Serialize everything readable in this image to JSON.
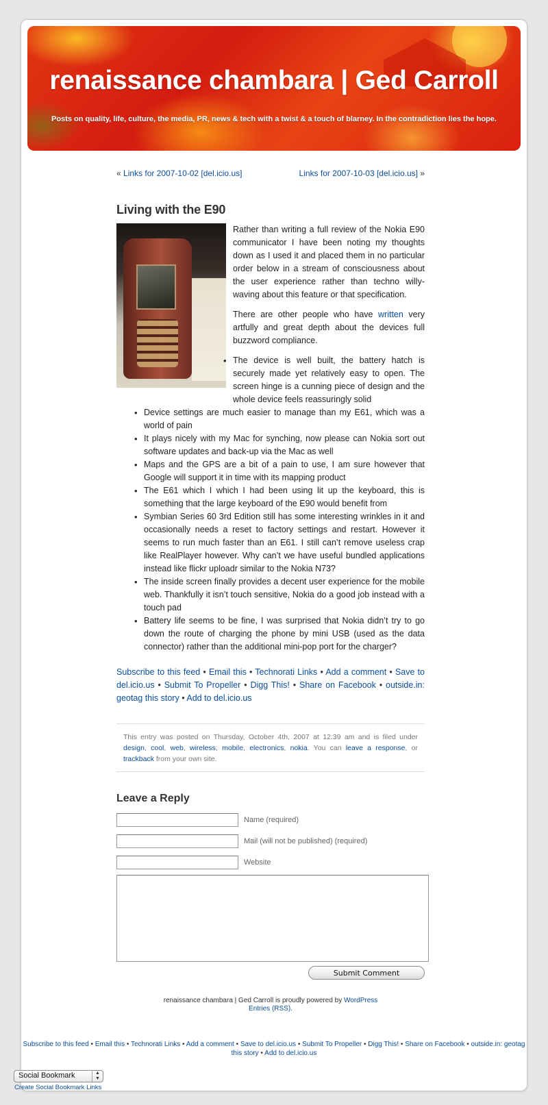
{
  "header": {
    "title": "renaissance chambara | Ged Carroll",
    "description": "Posts on quality, life, culture, the media, PR, news & tech with a twist & a touch of blarney. In the contradiction lies the hope."
  },
  "post_nav": {
    "prev_prefix": "« ",
    "prev_label": "Links for 2007-10-02 [del.icio.us]",
    "next_label": "Links for 2007-10-03 [del.icio.us]",
    "next_suffix": " »"
  },
  "post": {
    "title": "Living with the E90",
    "image_icon": "phone-photo",
    "paragraph1": "Rather than writing a full review of the Nokia E90 communicator I have been noting my thoughts down as I used it and placed them in no particular order below in a stream of consciousness about the user experience rather than techno willy-waving about this feature or that specification.",
    "paragraph2_before": "There are other people who have ",
    "paragraph2_link": "written",
    "paragraph2_after": " very artfully and great depth about the devices full buzzword compliance.",
    "bullets": [
      "The device is well built, the battery hatch is securely made yet relatively easy to open. The screen hinge is a cunning piece of design and the whole device feels reassuringly solid",
      "Device settings are much easier to manage than my E61, which was a world of pain",
      "It plays nicely with my Mac for synching, now please can Nokia sort out software updates and back-up via the Mac as well",
      "Maps and the GPS are a bit of a pain to use, I am sure however that Google will support it in time with its mapping product",
      "The E61 which I which I had been using lit up the keyboard, this is something that the large keyboard of the E90 would benefit from",
      "Symbian Series 60 3rd Edition still has some interesting wrinkles in it and occasionally needs a reset to factory settings and restart. However it seems to run much faster than an E61. I still can’t remove useless crap like RealPlayer however. Why can’t we have useful bundled applications instead like flickr uploadr similar to the Nokia N73?",
      "The inside screen finally provides a decent user experience for the mobile web. Thankfully it isn’t touch sensitive, Nokia do a good job instead with a touch pad",
      "Battery life seems to be fine, I was surprised that Nokia didn’t try to go down the route of charging the phone by mini USB (used as the data connector) rather than the additional mini-pop port for the charger?"
    ]
  },
  "share_links": [
    "Subscribe to this feed",
    "Email this",
    "Technorati Links",
    "Add a comment",
    "Save to del.icio.us",
    "Submit To Propeller",
    "Digg This!",
    "Share on Facebook",
    "outside.in: geotag this story",
    "Add to del.icio.us"
  ],
  "share_separator": " • ",
  "meta": {
    "text_before": "This entry was posted on Thursday, October 4th, 2007 at 12:39 am and is filed under ",
    "categories": [
      "design",
      "cool",
      "web",
      "wireless",
      "mobile",
      "electronics",
      "nokia"
    ],
    "text_you_can": ". You can ",
    "leave_response": "leave a response",
    "text_or": ", or ",
    "trackback": "trackback",
    "text_end": " from your own site."
  },
  "reply": {
    "title": "Leave a Reply",
    "name_label": "Name (required)",
    "name_value": "",
    "mail_label": "Mail (will not be published) (required)",
    "mail_value": "",
    "website_label": "Website",
    "website_value": "",
    "comment_value": "",
    "submit_label": "Submit Comment"
  },
  "footer": {
    "text": "renaissance chambara | Ged Carroll is proudly powered by ",
    "wordpress": "WordPress",
    "entries_rss": "Entries (RSS)",
    "period": "."
  },
  "bookmark": {
    "select_value": "Social Bookmark",
    "arrows_icon": "select-arrows",
    "link": "Create Social Bookmark Links"
  }
}
